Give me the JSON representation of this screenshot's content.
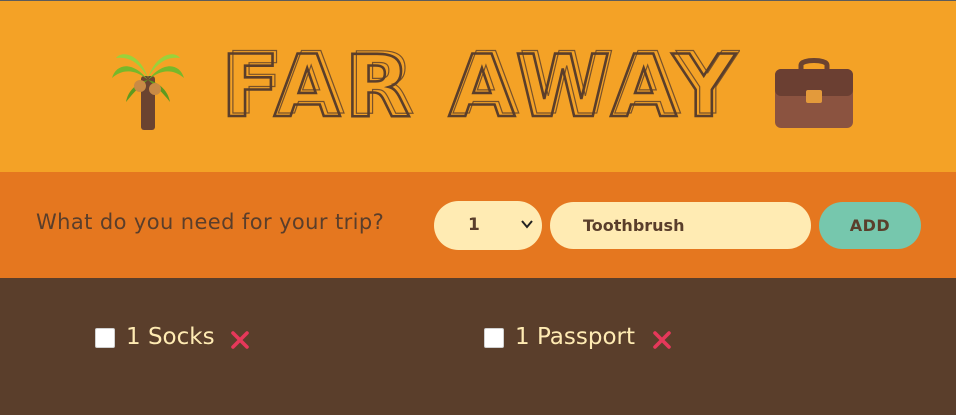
{
  "header": {
    "title": "FAR AWAY",
    "left_icon": "palm-tree-icon",
    "right_icon": "briefcase-icon"
  },
  "form": {
    "question": "What do you need for your trip?",
    "quantity_selected": "1",
    "item_value": "Toothbrush",
    "add_label": "ADD"
  },
  "packing_list": {
    "items": [
      {
        "quantity": "1",
        "description": "Socks",
        "label": "1 Socks",
        "packed": false,
        "delete_icon": "close-icon"
      },
      {
        "quantity": "1",
        "description": "Passport",
        "label": "1 Passport",
        "packed": false,
        "delete_icon": "close-icon"
      }
    ]
  },
  "colors": {
    "header_bg": "#f4a226",
    "form_bg": "#e5771f",
    "list_bg": "#5a3e2b",
    "text_dark": "#5a3e2b",
    "text_light": "#ffebb3",
    "add_button": "#76c7ad",
    "delete_x": "#e5385a"
  }
}
